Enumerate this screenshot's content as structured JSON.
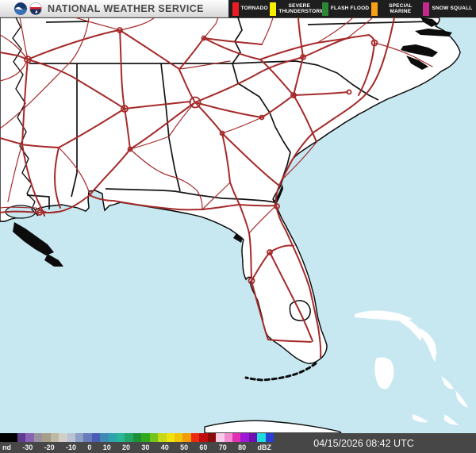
{
  "header": {
    "title": "NATIONAL WEATHER SERVICE",
    "logos": [
      {
        "name": "noaa-logo"
      },
      {
        "name": "nws-logo"
      }
    ],
    "warnings": [
      {
        "label": "TORNADO",
        "color": "#ec1c24"
      },
      {
        "label": "SEVERE THUNDERSTORM",
        "color": "#f7ef00"
      },
      {
        "label": "FLASH FLOOD",
        "color": "#2d8633"
      },
      {
        "label": "SPECIAL MARINE",
        "color": "#f6a117"
      },
      {
        "label": "SNOW SQUALL",
        "color": "#c4288c"
      }
    ]
  },
  "map": {
    "region": "Southeast United States radar composite",
    "water_color": "#c7e8f1",
    "land_color": "#ffffff",
    "county_line_color": "#cdcdcd",
    "state_line_color": "#141414",
    "road_color": "#a52a2a"
  },
  "colorbar": {
    "units_label": "dBZ",
    "tick_labels": [
      "nd",
      "-30",
      "-20",
      "-10",
      "0",
      "10",
      "20",
      "30",
      "40",
      "50",
      "60",
      "70",
      "80",
      "dBZ"
    ],
    "segments": [
      "#000000",
      "#5f3a8f",
      "#8a62b4",
      "#98929e",
      "#a79e8a",
      "#bfb8a2",
      "#d0cfc8",
      "#b9c3d5",
      "#8ea0c6",
      "#687bba",
      "#4a5cb4",
      "#3f8ab4",
      "#2fa3ad",
      "#28b496",
      "#21a765",
      "#1b9038",
      "#2fa81e",
      "#73c41b",
      "#c5d915",
      "#efe30d",
      "#f2c408",
      "#f09c04",
      "#eb2a0f",
      "#c00d0d",
      "#8b0a0a",
      "#f8cce6",
      "#f38bd0",
      "#e330b3",
      "#a017d7",
      "#6e0fb1",
      "#1edcdc",
      "#2c3ed5"
    ]
  },
  "status": {
    "timestamp": "04/15/2026 08:42 UTC"
  }
}
